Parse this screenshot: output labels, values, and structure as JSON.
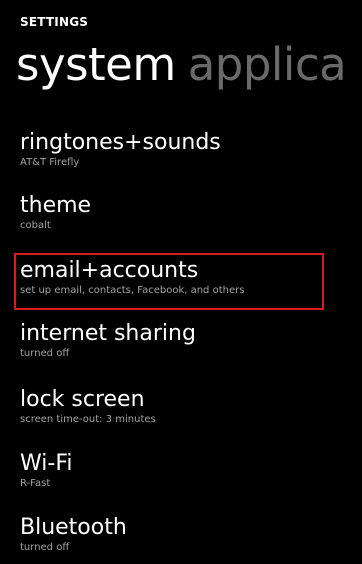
{
  "header": {
    "app_title": "SETTINGS",
    "pivot_active": "system",
    "pivot_next": "applica"
  },
  "items": [
    {
      "title": "ringtones+sounds",
      "subtitle": "AT&T Firefly"
    },
    {
      "title": "theme",
      "subtitle": "cobalt"
    },
    {
      "title": "email+accounts",
      "subtitle": "set up email, contacts, Facebook, and others"
    },
    {
      "title": "internet sharing",
      "subtitle": "turned off"
    },
    {
      "title": "lock screen",
      "subtitle": "screen time-out: 3 minutes"
    },
    {
      "title": "Wi-Fi",
      "subtitle": "R-Fast"
    },
    {
      "title": "Bluetooth",
      "subtitle": "turned off"
    }
  ],
  "colors": {
    "background": "#000000",
    "text": "#ffffff",
    "subtitle": "#a3a3a3",
    "inactive_pivot": "#6a6a6a",
    "highlight": "#d61c1c"
  }
}
